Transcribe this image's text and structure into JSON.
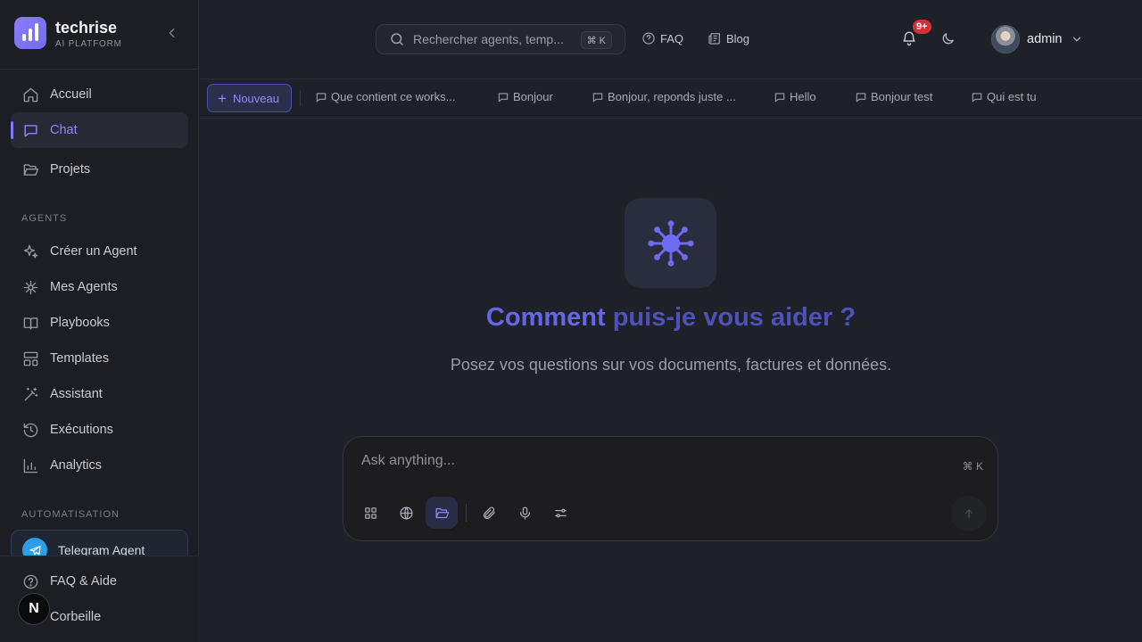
{
  "brand": {
    "name": "techrise",
    "subtitle": "AI PLATFORM"
  },
  "nav": {
    "main": [
      {
        "label": "Accueil",
        "icon": "home-icon"
      },
      {
        "label": "Chat",
        "icon": "chat-icon",
        "active": true
      },
      {
        "label": "Projets",
        "icon": "folder-open-icon"
      }
    ],
    "agents_section": "AGENTS",
    "agents": [
      {
        "label": "Créer un Agent",
        "icon": "sparkles-icon"
      },
      {
        "label": "Mes Agents",
        "icon": "agents-icon"
      },
      {
        "label": "Playbooks",
        "icon": "book-icon"
      },
      {
        "label": "Templates",
        "icon": "layout-icon"
      },
      {
        "label": "Assistant",
        "icon": "magic-wand-icon"
      },
      {
        "label": "Exécutions",
        "icon": "history-icon"
      },
      {
        "label": "Analytics",
        "icon": "bar-chart-icon"
      }
    ],
    "automation_section": "AUTOMATISATION",
    "telegram": "Telegram Agent",
    "bottom": [
      {
        "label": "FAQ & Aide",
        "icon": "help-circle-icon"
      },
      {
        "label": "Corbeille",
        "icon": "trash-icon"
      }
    ],
    "badge_letter": "N"
  },
  "header": {
    "search_placeholder": "Rechercher agents, temp...",
    "search_shortcut": "⌘ K",
    "faq": "FAQ",
    "blog": "Blog",
    "notifications": "9+",
    "username": "admin"
  },
  "tabs": {
    "new_label": "Nouveau",
    "items": [
      "Que contient ce works...",
      "Bonjour",
      "Bonjour, reponds juste ...",
      "Hello",
      "Bonjour test",
      "Qui est tu"
    ]
  },
  "main": {
    "title_part1": "Comment ",
    "title_part2": "puis-je vous aider ?",
    "subtitle": "Posez vos questions sur vos documents, factures et données.",
    "input_placeholder": "Ask anything...",
    "input_shortcut": "⌘ K"
  },
  "colors": {
    "accent": "#7c7af5",
    "badge": "#d32f34",
    "telegram": "#2aa0e8"
  }
}
